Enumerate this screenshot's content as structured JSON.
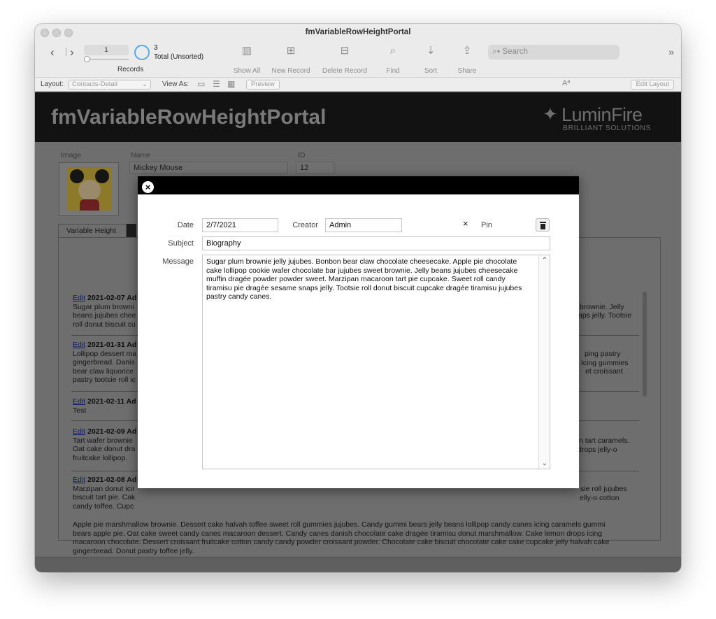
{
  "window": {
    "title": "fmVariableRowHeightPortal"
  },
  "toolbar": {
    "record_current": "1",
    "found_count": "3",
    "total_label": "Total (Unsorted)",
    "records_label": "Records",
    "show_all": "Show All",
    "new_record": "New Record",
    "delete_record": "Delete Record",
    "find": "Find",
    "sort": "Sort",
    "share": "Share",
    "search_placeholder": "Search",
    "more_glyph": "»"
  },
  "layout_bar": {
    "layout_label": "Layout:",
    "layout_value": "Contacts-Detail",
    "view_as_label": "View As:",
    "preview": "Preview",
    "font_size_glyph": "Aª",
    "edit_layout": "Edit Layout"
  },
  "header": {
    "app_title": "fmVariableRowHeightPortal",
    "logo_name": "LuminFire",
    "logo_tagline": "BRILLIANT SOLUTIONS"
  },
  "record": {
    "image_label": "Image",
    "name_label": "Name",
    "name_value": "Mickey Mouse",
    "id_label": "ID",
    "id_value": "12"
  },
  "tabs": {
    "active": "Variable Height"
  },
  "portal_rows": [
    {
      "edit": "Edit",
      "date": "2021-02-07 Ad",
      "lines": [
        "Sugar plum browni",
        "beans jujubes chee",
        "roll donut biscuit cu"
      ],
      "right_lines": [
        "brownie. Jelly",
        "aps jelly. Tootsie"
      ]
    },
    {
      "edit": "Edit",
      "date": "2021-01-31 Ad",
      "lines": [
        "Lollipop dessert ma",
        "gingerbread. Danis",
        "bear claw liquorice",
        "pastry tootsie roll ic"
      ],
      "right_lines": [
        "ping pastry",
        ". Icing gummies",
        "et croissant"
      ]
    },
    {
      "edit": "Edit",
      "date": "2021-02-11 Ad",
      "lines": [
        "Test"
      ],
      "right_lines": []
    },
    {
      "edit": "Edit",
      "date": "2021-02-09 Ad",
      "lines": [
        "Tart wafer brownie",
        "Oat cake donut dra",
        "fruitcake lollipop."
      ],
      "right_lines": [
        "n tart caramels.",
        "drops jelly-o"
      ]
    },
    {
      "edit": "Edit",
      "date": "2021-02-08 Ad",
      "lines": [
        "Marzipan donut icir",
        "biscuit tart pie. Cak",
        "candy toffee. Cupc"
      ],
      "right_lines": [
        "sie roll jujubes",
        "elly-o cotton"
      ]
    }
  ],
  "portal_paragraph": [
    "Apple pie marshmallow brownie. Dessert cake halvah toffee sweet roll gummies jujubes. Candy gummi bears jelly beans lollipop candy canes icing caramels gummi",
    "bears apple pie. Oat cake sweet candy canes macaroon dessert. Candy canes danish chocolate cake dragée tiramisu donut marshmallow. Cake lemon drops icing",
    "macaroon chocolate. Dessert croissant fruitcake cotton candy candy powder croissant powder. Chocolate cake biscuit chocolate cake cake cupcake jelly halvah cake",
    "gingerbread. Donut pastry toffee jelly."
  ],
  "modal": {
    "close_glyph": "×",
    "date_label": "Date",
    "date_value": "2/7/2021",
    "creator_label": "Creator",
    "creator_value": "Admin",
    "pin_mark": "×",
    "pin_label": "Pin",
    "subject_label": "Subject",
    "subject_value": "Biography",
    "message_label": "Message",
    "message_lines": [
      "Sugar plum brownie jelly jujubes. Bonbon bear claw chocolate cheesecake. Apple pie chocolate",
      "cake lollipop cookie wafer chocolate bar jujubes sweet brownie. Jelly beans jujubes cheesecake",
      "muffin dragée powder powder sweet. Marzipan macaroon tart pie cupcake. Sweet roll candy",
      "tiramisu pie dragée sesame snaps jelly. Tootsie roll donut biscuit cupcake dragée tiramisu jujubes",
      "pastry candy canes."
    ]
  }
}
